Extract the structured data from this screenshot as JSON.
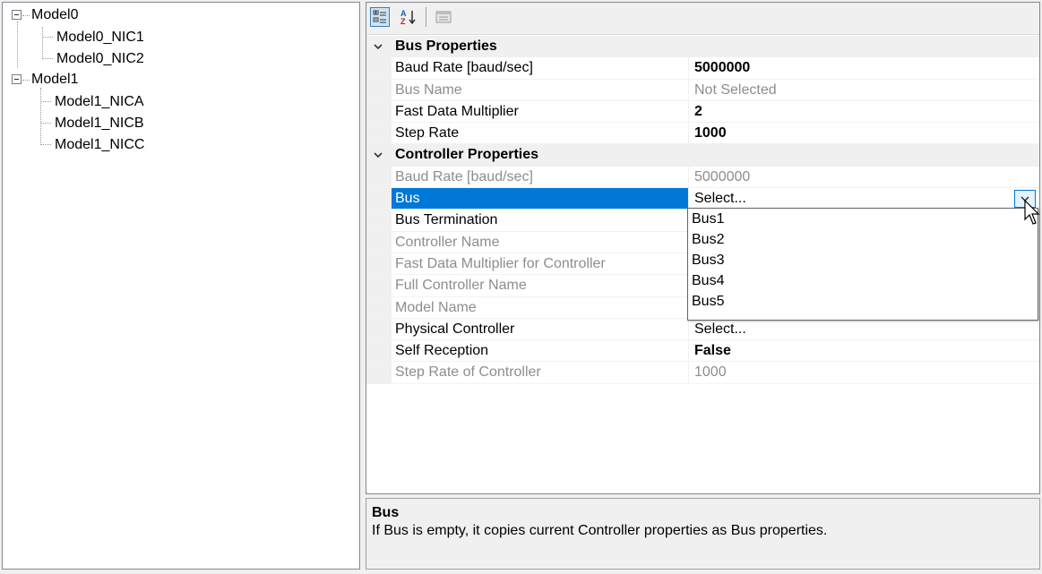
{
  "tree": {
    "nodes": [
      {
        "label": "Model0",
        "expanded": true
      },
      {
        "label": "Model0_NIC1"
      },
      {
        "label": "Model0_NIC2"
      },
      {
        "label": "Model1",
        "expanded": true
      },
      {
        "label": "Model1_NICA"
      },
      {
        "label": "Model1_NICB"
      },
      {
        "label": "Model1_NICC"
      }
    ]
  },
  "toolbar": {
    "categorized_icon": "categorized-view-icon",
    "alphabetical_icon": "sort-az-icon",
    "property_pages_icon": "property-pages-icon"
  },
  "property_grid": {
    "categories": [
      {
        "label": "Bus Properties",
        "rows": [
          {
            "name": "Baud Rate [baud/sec]",
            "value": "5000000",
            "readonly": false,
            "bold": true
          },
          {
            "name": "Bus Name",
            "value": "Not Selected",
            "readonly": true,
            "bold": false
          },
          {
            "name": "Fast Data Multiplier",
            "value": "2",
            "readonly": false,
            "bold": true
          },
          {
            "name": "Step Rate",
            "value": "1000",
            "readonly": false,
            "bold": true
          }
        ]
      },
      {
        "label": "Controller Properties",
        "rows": [
          {
            "name": "Baud Rate [baud/sec]",
            "value": "5000000",
            "readonly": true,
            "bold": false
          },
          {
            "name": "Bus",
            "value": "Select...",
            "readonly": false,
            "bold": false,
            "selected": true
          },
          {
            "name": "Bus Termination",
            "value": "",
            "readonly": false,
            "bold": false
          },
          {
            "name": "Controller Name",
            "value": "",
            "readonly": true,
            "bold": false
          },
          {
            "name": "Fast Data Multiplier for Controller",
            "value": "",
            "readonly": true,
            "bold": false
          },
          {
            "name": "Full Controller Name",
            "value": "",
            "readonly": true,
            "bold": false
          },
          {
            "name": "Model Name",
            "value": "",
            "readonly": true,
            "bold": false
          },
          {
            "name": "Physical Controller",
            "value": "Select...",
            "readonly": false,
            "bold": false
          },
          {
            "name": "Self Reception",
            "value": "False",
            "readonly": false,
            "bold": true
          },
          {
            "name": "Step Rate of Controller",
            "value": "1000",
            "readonly": true,
            "bold": false
          }
        ]
      }
    ],
    "dropdown_options": [
      "Bus1",
      "Bus2",
      "Bus3",
      "Bus4",
      "Bus5"
    ]
  },
  "description": {
    "title": "Bus",
    "text": "If Bus is empty, it copies current Controller properties as Bus properties."
  },
  "colors": {
    "selection": "#0078d7",
    "readonly_text": "#8d8d8d",
    "category_bg": "#f0f0f0"
  }
}
